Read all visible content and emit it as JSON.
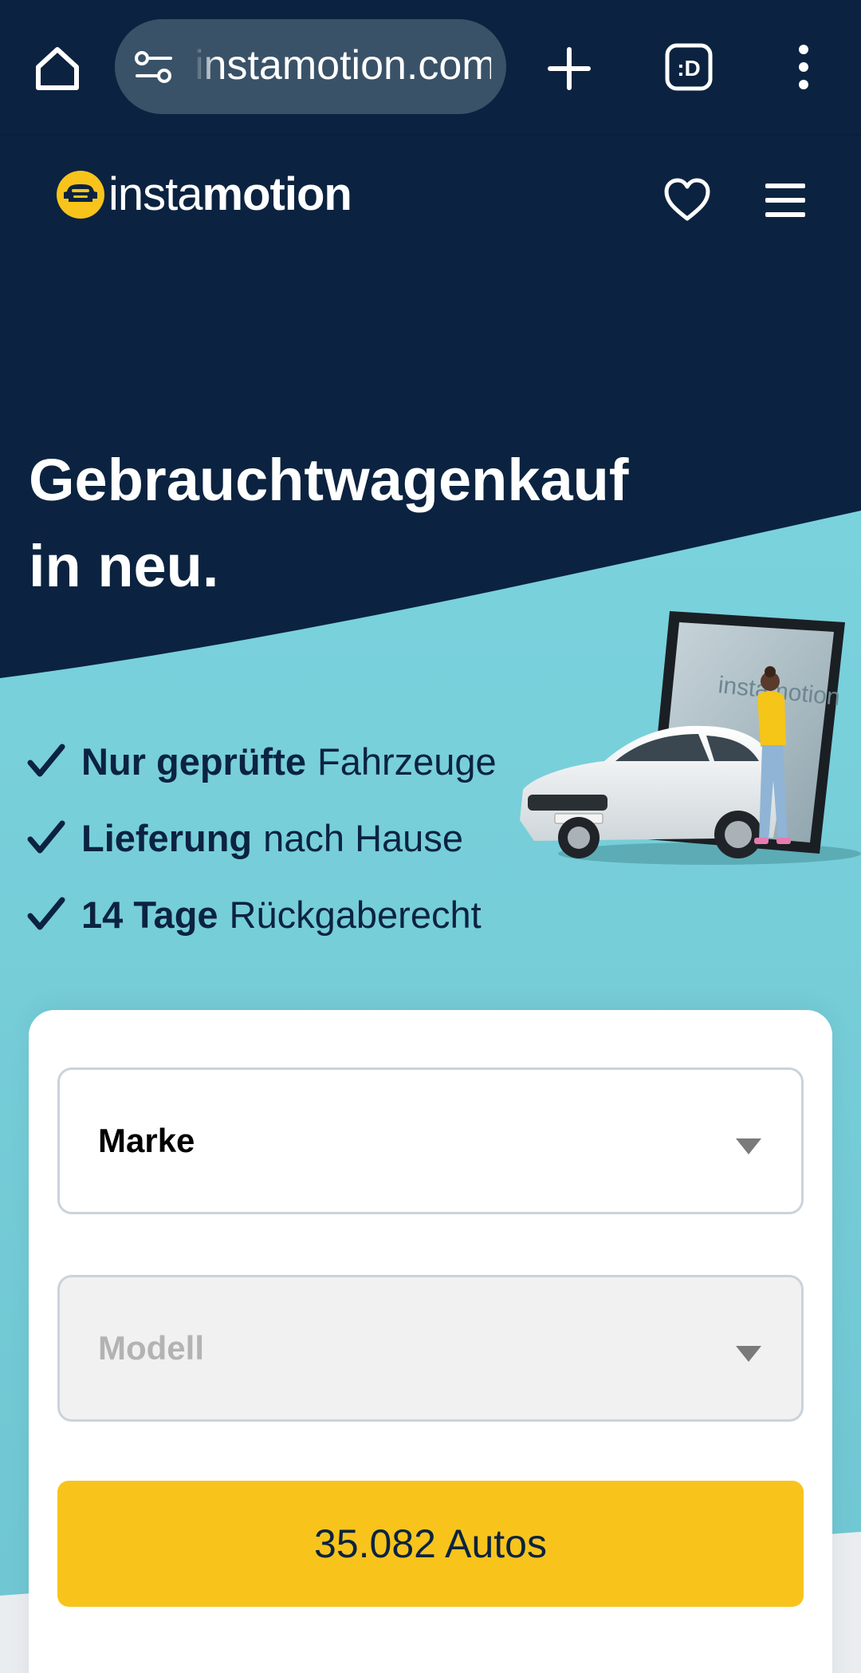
{
  "browser": {
    "url": "instamotion.com",
    "home_icon": "home-icon",
    "site_settings_icon": "tune-icon",
    "new_tab_icon": "plus-icon",
    "tab_switcher_icon": "tab-switcher-icon",
    "tab_switcher_label": ":D",
    "menu_icon": "more-vert-icon"
  },
  "header": {
    "logo_light": "insta",
    "logo_bold": "motion",
    "favorites_icon": "heart-icon",
    "menu_icon": "hamburger-icon"
  },
  "hero": {
    "title_line1": "Gebrauchtwagenkauf",
    "title_line2": "in neu.",
    "benefits": [
      {
        "strong": "Nur geprüfte",
        "rest": "Fahrzeuge"
      },
      {
        "strong": "Lieferung",
        "rest": "nach Hause"
      },
      {
        "strong": "14 Tage",
        "rest": "Rückgaberecht"
      }
    ]
  },
  "search": {
    "brand_select": {
      "label": "Marke",
      "icon": "caret-down-icon"
    },
    "model_select": {
      "label": "Modell",
      "icon": "caret-down-icon",
      "disabled": true
    },
    "cta_label": "35.082 Autos"
  },
  "colors": {
    "navy": "#0b2340",
    "teal": "#79d1dc",
    "yellow": "#f8c41c",
    "url_pill": "#3a5268"
  }
}
